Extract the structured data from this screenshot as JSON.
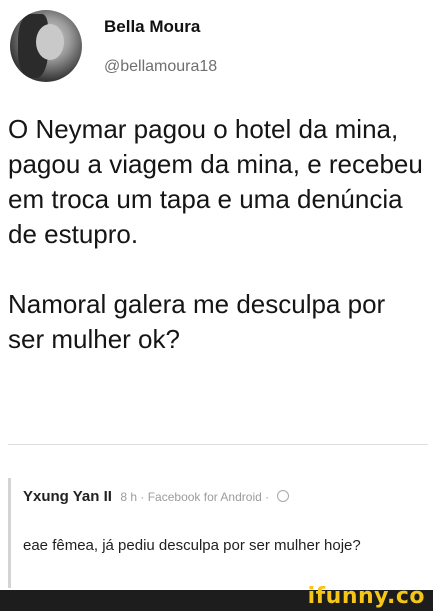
{
  "tweet": {
    "display_name": "Bella Moura",
    "handle": "@bellamoura18",
    "paragraphs": [
      "O Neymar pagou o hotel da mina, pagou a viagem da mina, e recebeu em troca um tapa e uma denúncia de estupro.",
      "Namoral galera me desculpa por ser mulher ok?"
    ]
  },
  "comment": {
    "author": "Yxung Yan II",
    "meta": "8 h · Facebook for Android ·",
    "text": "eae fêmea, já pediu desculpa por ser mulher hoje?"
  },
  "watermark": {
    "text": "ifunny.co",
    "color": "#f5c518"
  }
}
